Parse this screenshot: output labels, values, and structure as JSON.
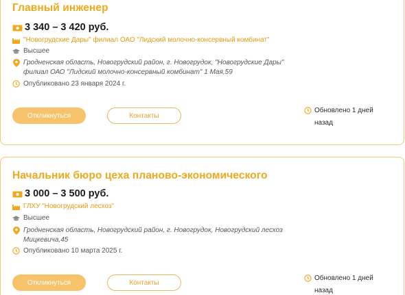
{
  "jobs": [
    {
      "title": "Главный инженер",
      "salary": "3 340 – 3 420 руб.",
      "organization": "\"Новогрудские Дары\" филиал ОАО \"Лидский молочно-консервный комбинат\"",
      "education": "Высшее",
      "address": "Гродненская область, Новогрудский район, г. Новогрудок, \"Новогрудские Дары\" филиал ОАО \"Лидский молочно-консервный комбинат\" 1 Мая,59",
      "published": "Опубликовано 23 января 2024 г.",
      "respond_label": "Откликнуться",
      "contacts_label": "Контакты",
      "updated": "Обновлено 1 дней назад"
    },
    {
      "title": "Начальник бюро цеха планово-экономического",
      "salary": "3 000 – 3 500 руб.",
      "organization": "ГЛХУ \"Новогрудский лесхоз\"",
      "education": "Высшее",
      "address": "Гродненская область, Новогрудский район, г. Новогрудок, Новогрудский лесхоз Мицкевича,45",
      "published": "Опубликовано 10 марта 2025 г.",
      "respond_label": "Откликнуться",
      "contacts_label": "Контакты",
      "updated": "Обновлено 1 дней назад"
    }
  ],
  "colors": {
    "accent": "#f0a81c",
    "border": "#f3c876",
    "button_fill": "#f6c26a"
  },
  "icons": [
    "money-icon",
    "factory-icon",
    "graduation-cap-icon",
    "location-pin-icon",
    "clock-icon"
  ]
}
